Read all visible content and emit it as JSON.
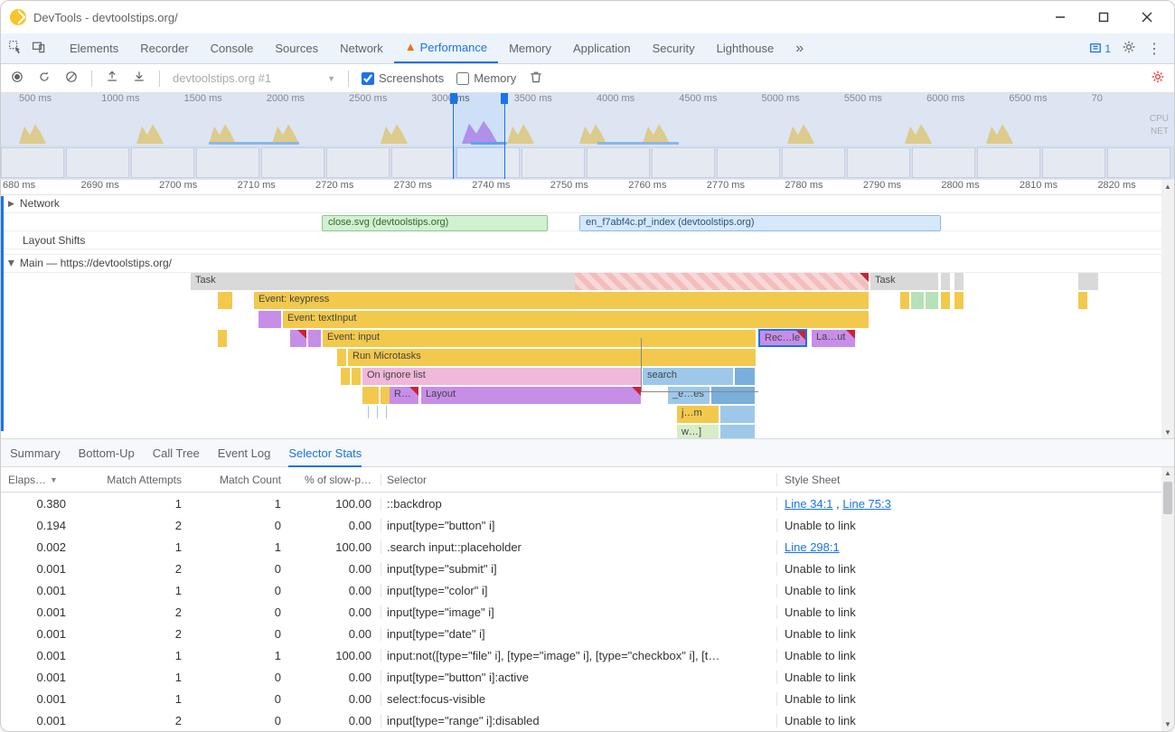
{
  "window": {
    "title": "DevTools - devtoolstips.org/"
  },
  "tabs": {
    "items": [
      "Elements",
      "Recorder",
      "Console",
      "Sources",
      "Network",
      "Performance",
      "Memory",
      "Application",
      "Security",
      "Lighthouse"
    ],
    "active": "Performance",
    "issue_count": "1"
  },
  "subbar": {
    "dropdown": "devtoolstips.org #1",
    "screenshots_label": "Screenshots",
    "memory_label": "Memory",
    "screenshots_checked": true,
    "memory_checked": false
  },
  "overview": {
    "ticks": [
      "500 ms",
      "1000 ms",
      "1500 ms",
      "2000 ms",
      "2500 ms",
      "3000 ms",
      "3500 ms",
      "4000 ms",
      "4500 ms",
      "5000 ms",
      "5500 ms",
      "6000 ms",
      "6500 ms",
      "70"
    ],
    "right_labels": [
      "CPU",
      "NET"
    ]
  },
  "flame": {
    "ruler": [
      "680 ms",
      "2690 ms",
      "2700 ms",
      "2710 ms",
      "2720 ms",
      "2730 ms",
      "2740 ms",
      "2750 ms",
      "2760 ms",
      "2770 ms",
      "2780 ms",
      "2790 ms",
      "2800 ms",
      "2810 ms",
      "2820 ms"
    ],
    "tracks": {
      "network_label": "Network",
      "layout_shifts_label": "Layout Shifts",
      "main_label": "Main — https://devtoolstips.org/",
      "net_a": "close.svg (devtoolstips.org)",
      "net_b": "en_f7abf4c.pf_index (devtoolstips.org)"
    },
    "bars": {
      "task1": "Task",
      "task2": "Task",
      "keypress": "Event: keypress",
      "textinput": "Event: textInput",
      "input": "Event: input",
      "microtasks": "Run Microtasks",
      "ignorelist": "On ignore list",
      "r": "R…",
      "layout": "Layout",
      "search": "search",
      "recalc": "Rec…le",
      "layout2": "La…ut",
      "ees": "_e…es",
      "jm": "j…m",
      "wj": "w…]"
    }
  },
  "bottom_tabs": {
    "items": [
      "Summary",
      "Bottom-Up",
      "Call Tree",
      "Event Log",
      "Selector Stats"
    ],
    "active": "Selector Stats"
  },
  "table": {
    "headers": {
      "elapsed": "Elaps…",
      "attempts": "Match Attempts",
      "count": "Match Count",
      "slow": "% of slow-p…",
      "selector": "Selector",
      "sheet": "Style Sheet"
    },
    "rows": [
      {
        "elapsed": "0.380",
        "attempts": "1",
        "count": "1",
        "slow": "100.00",
        "selector": "::backdrop",
        "sheet": {
          "links": [
            "Line 34:1",
            "Line 75:3"
          ],
          "sep": " , "
        }
      },
      {
        "elapsed": "0.194",
        "attempts": "2",
        "count": "0",
        "slow": "0.00",
        "selector": "input[type=\"button\" i]",
        "sheet": {
          "text": "Unable to link"
        }
      },
      {
        "elapsed": "0.002",
        "attempts": "1",
        "count": "1",
        "slow": "100.00",
        "selector": ".search input::placeholder",
        "sheet": {
          "links": [
            "Line 298:1"
          ]
        }
      },
      {
        "elapsed": "0.001",
        "attempts": "2",
        "count": "0",
        "slow": "0.00",
        "selector": "input[type=\"submit\" i]",
        "sheet": {
          "text": "Unable to link"
        }
      },
      {
        "elapsed": "0.001",
        "attempts": "1",
        "count": "0",
        "slow": "0.00",
        "selector": "input[type=\"color\" i]",
        "sheet": {
          "text": "Unable to link"
        }
      },
      {
        "elapsed": "0.001",
        "attempts": "2",
        "count": "0",
        "slow": "0.00",
        "selector": "input[type=\"image\" i]",
        "sheet": {
          "text": "Unable to link"
        }
      },
      {
        "elapsed": "0.001",
        "attempts": "2",
        "count": "0",
        "slow": "0.00",
        "selector": "input[type=\"date\" i]",
        "sheet": {
          "text": "Unable to link"
        }
      },
      {
        "elapsed": "0.001",
        "attempts": "1",
        "count": "1",
        "slow": "100.00",
        "selector": "input:not([type=\"file\" i], [type=\"image\" i], [type=\"checkbox\" i], [t…",
        "sheet": {
          "text": "Unable to link"
        }
      },
      {
        "elapsed": "0.001",
        "attempts": "1",
        "count": "0",
        "slow": "0.00",
        "selector": "input[type=\"button\" i]:active",
        "sheet": {
          "text": "Unable to link"
        }
      },
      {
        "elapsed": "0.001",
        "attempts": "1",
        "count": "0",
        "slow": "0.00",
        "selector": "select:focus-visible",
        "sheet": {
          "text": "Unable to link"
        }
      },
      {
        "elapsed": "0.001",
        "attempts": "2",
        "count": "0",
        "slow": "0.00",
        "selector": "input[type=\"range\" i]:disabled",
        "sheet": {
          "text": "Unable to link"
        }
      }
    ]
  }
}
